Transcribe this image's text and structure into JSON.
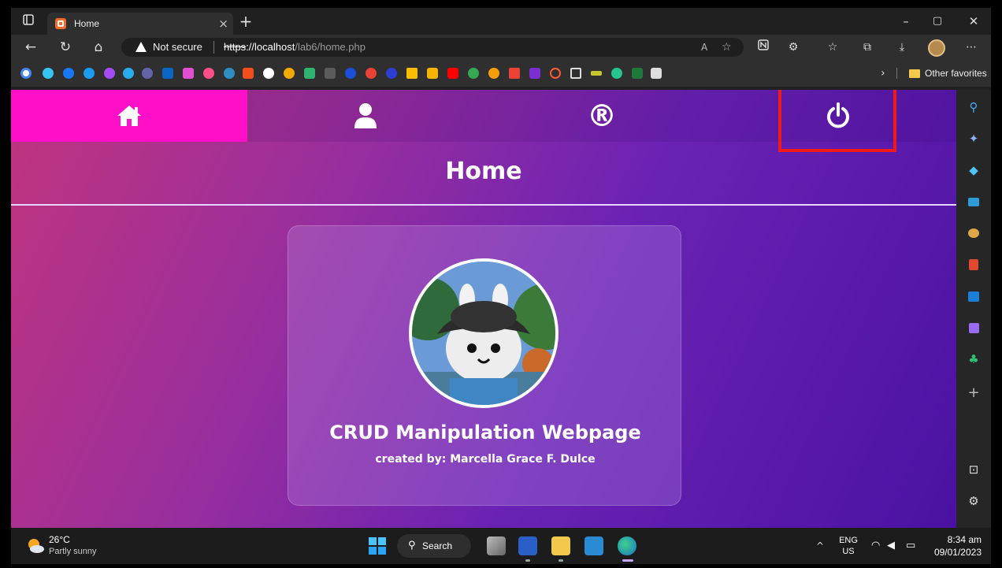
{
  "browser": {
    "tab_title": "Home",
    "tab_close": "×",
    "new_tab": "+",
    "security_label": "Not secure",
    "url_scheme": "https",
    "url_host": "://localhost",
    "url_path": "/lab6/home.php",
    "other_favorites": "Other favorites",
    "window_controls": {
      "minimize": "–",
      "maximize": "▢",
      "close": "✕"
    }
  },
  "site": {
    "nav": [
      {
        "name": "home",
        "icon": "home-icon",
        "active": true
      },
      {
        "name": "profile",
        "icon": "user-icon"
      },
      {
        "name": "register",
        "icon": "registered-icon",
        "glyph": "®"
      },
      {
        "name": "logout",
        "icon": "power-icon"
      }
    ],
    "active_color": "#ff10c8",
    "highlight_color": "#ef1b1b",
    "page_title": "Home",
    "card": {
      "title": "CRUD Manipulation Webpage",
      "subtitle": "created by: Marcella Grace F. Dulce"
    }
  },
  "taskbar": {
    "temperature": "26°C",
    "condition": "Partly sunny",
    "search_label": "Search",
    "lang_top": "ENG",
    "lang_bottom": "US",
    "time": "8:34 am",
    "date": "09/01/2023"
  }
}
